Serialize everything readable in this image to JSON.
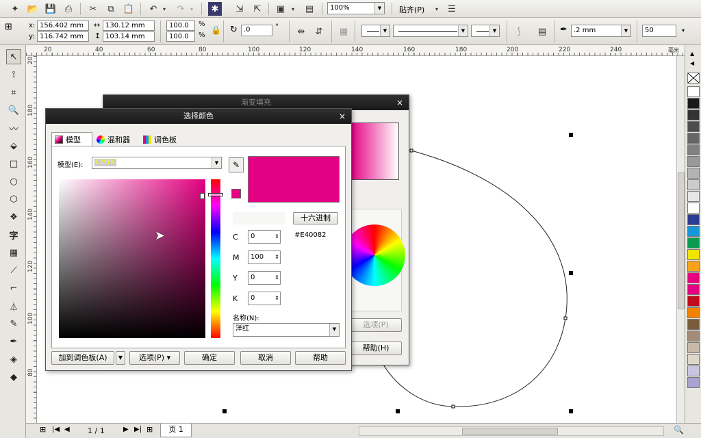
{
  "toolbar": {
    "zoom_value": "100%",
    "snap_label": "贴齐(P)"
  },
  "propbar": {
    "x_label": "x:",
    "y_label": "y:",
    "x_value": "156.402 mm",
    "y_value": "116.742 mm",
    "width_value": "130.12 mm",
    "height_value": "103.14 mm",
    "scale_x": "100.0",
    "scale_y": "100.0",
    "percent": "%",
    "rotation": ".0",
    "degree": "°",
    "outline_width": ".2 mm",
    "nodes_value": "50"
  },
  "hruler_ticks": [
    "20",
    "40",
    "60",
    "80",
    "100",
    "120",
    "140",
    "160",
    "180",
    "200",
    "220",
    "240"
  ],
  "hruler_unit": "毫米",
  "vruler_ticks": [
    "200",
    "180",
    "160",
    "140",
    "120",
    "100",
    "80"
  ],
  "status": {
    "page_count": "1 / 1",
    "page_tab": "页 1"
  },
  "fountain_dialog": {
    "title": "渐变填充",
    "options_button": "选项(P)",
    "help_button": "帮助(H)"
  },
  "color_dialog": {
    "title": "选择颜色",
    "tabs": [
      {
        "label": "模型"
      },
      {
        "label": "混和器"
      },
      {
        "label": "调色板"
      }
    ],
    "model_label": "模型(E):",
    "model_value": "CMYK",
    "hex_button": "十六进制",
    "hex_value": "#E40082",
    "c_label": "C",
    "m_label": "M",
    "y_label": "Y",
    "k_label": "K",
    "c_value": "0",
    "m_value": "100",
    "y_value": "0",
    "k_value": "0",
    "name_label": "名称(N):",
    "name_value": "洋红",
    "add_palette_button": "加到调色板(A)",
    "options_button": "选项(P)",
    "ok_button": "确定",
    "cancel_button": "取消",
    "help_button": "帮助",
    "preview_color": "#E40082"
  },
  "palette_colors": [
    "#ffffff",
    "#1a1a1a",
    "#333333",
    "#4d4d4d",
    "#666666",
    "#808080",
    "#999999",
    "#b3b3b3",
    "#cccccc",
    "#e6e6e6",
    "#ffffff",
    "#2a3d91",
    "#1996d8",
    "#0a9a52",
    "#f0e500",
    "#f5a31c",
    "#e4007f",
    "#e40082",
    "#c00a1e",
    "#f08300",
    "#7a5c3c",
    "#a08c78",
    "#c8b9a8",
    "#ded6ca",
    "#c9c5e0",
    "#a9a3cf"
  ]
}
